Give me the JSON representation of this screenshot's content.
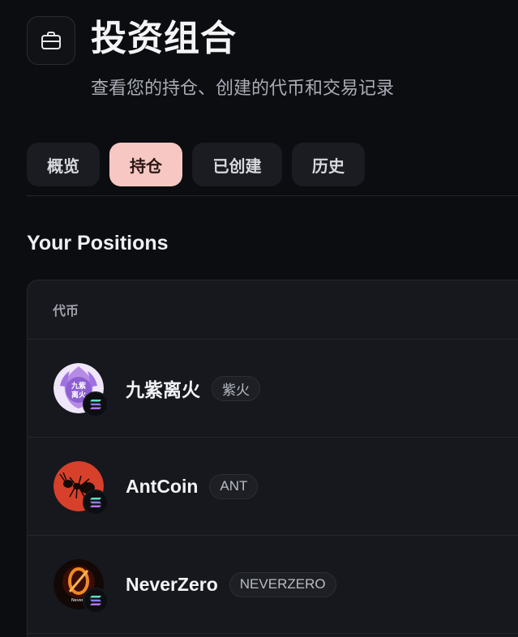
{
  "header": {
    "icon": "briefcase-icon",
    "title": "投资组合",
    "subtitle": "查看您的持仓、创建的代币和交易记录"
  },
  "tabs": [
    {
      "label": "概览",
      "active": false
    },
    {
      "label": "持仓",
      "active": true
    },
    {
      "label": "已创建",
      "active": false
    },
    {
      "label": "历史",
      "active": false
    }
  ],
  "section": {
    "title": "Your Positions"
  },
  "table": {
    "columns": [
      "代币"
    ],
    "rows": [
      {
        "name": "九紫离火",
        "symbol": "紫火",
        "avatar_text": "九紫离火",
        "chain_icon": "solana-icon"
      },
      {
        "name": "AntCoin",
        "symbol": "ANT",
        "avatar_text": "",
        "chain_icon": "solana-icon"
      },
      {
        "name": "NeverZero",
        "symbol": "NEVERZERO",
        "avatar_text": "Never 0",
        "chain_icon": "solana-icon"
      }
    ]
  },
  "colors": {
    "background": "#0c0d10",
    "active_tab": "#f7c8c3",
    "card": "#16181d"
  }
}
